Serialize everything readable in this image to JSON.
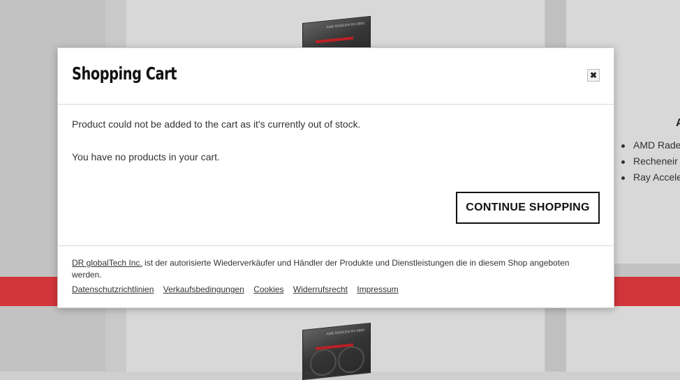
{
  "modal": {
    "title": "Shopping Cart",
    "close_symbol": "✖",
    "message_error": "Product could not be added to the cart as it's currently out of stock.",
    "message_empty": "You have no products in your cart.",
    "continue_label": "CONTINUE SHOPPING"
  },
  "footer": {
    "company_link": "DR globalTech Inc.",
    "company_text": " ist der autorisierte Wiederverkäufer und Händler der Produkte und Dienstleistungen die in diesem Shop angeboten werden.",
    "links": [
      "Datenschutzrichtlinien",
      "Verkaufsbedingungen",
      "Cookies",
      "Widerrufsrecht",
      "Impressum"
    ]
  },
  "background": {
    "side_heading": "A",
    "side_bullets": [
      "AMD Rade",
      "Recheneir",
      "Ray Accele"
    ],
    "gpu_text": "AMD RADEON RX 6800"
  },
  "colors": {
    "accent_red": "#e03a3e",
    "page_bg": "#cfcfcf"
  },
  "icons": {
    "close": "close-icon"
  }
}
